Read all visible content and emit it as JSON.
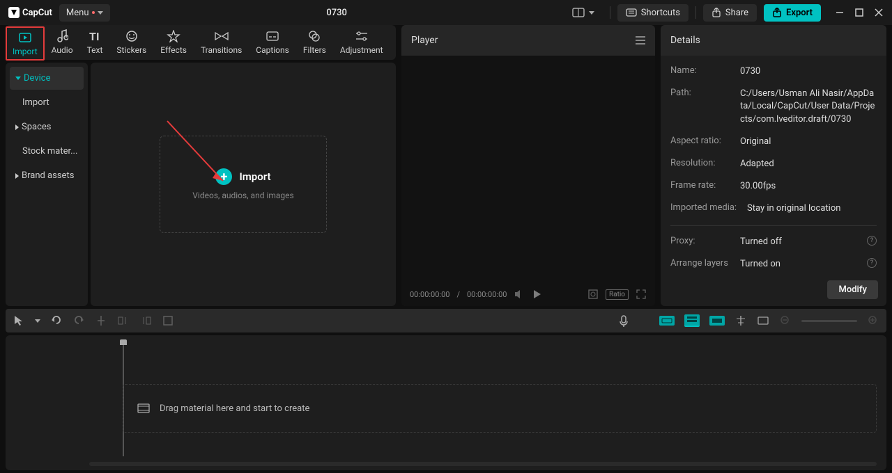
{
  "app": {
    "name": "CapCut",
    "project_title": "0730"
  },
  "titlebar": {
    "menu_label": "Menu",
    "shortcuts": "Shortcuts",
    "share": "Share",
    "export": "Export"
  },
  "tabs": {
    "import": "Import",
    "audio": "Audio",
    "text": "Text",
    "stickers": "Stickers",
    "effects": "Effects",
    "transitions": "Transitions",
    "captions": "Captions",
    "filters": "Filters",
    "adjustment": "Adjustment"
  },
  "sidebar": {
    "device": "Device",
    "import": "Import",
    "spaces": "Spaces",
    "stock": "Stock mater...",
    "brand": "Brand assets"
  },
  "import_box": {
    "title": "Import",
    "subtitle": "Videos, audios, and images"
  },
  "player": {
    "title": "Player",
    "time_current": "00:00:00:00",
    "time_total": "00:00:00:00",
    "ratio_label": "Ratio"
  },
  "details": {
    "title": "Details",
    "name_label": "Name:",
    "name_value": "0730",
    "path_label": "Path:",
    "path_value": "C:/Users/Usman Ali Nasir/AppData/Local/CapCut/User Data/Projects/com.lveditor.draft/0730",
    "aspect_label": "Aspect ratio:",
    "aspect_value": "Original",
    "resolution_label": "Resolution:",
    "resolution_value": "Adapted",
    "framerate_label": "Frame rate:",
    "framerate_value": "30.00fps",
    "imported_label": "Imported media:",
    "imported_value": "Stay in original location",
    "proxy_label": "Proxy:",
    "proxy_value": "Turned off",
    "layers_label": "Arrange layers",
    "layers_value": "Turned on",
    "modify": "Modify"
  },
  "timeline": {
    "drop_hint": "Drag material here and start to create"
  }
}
